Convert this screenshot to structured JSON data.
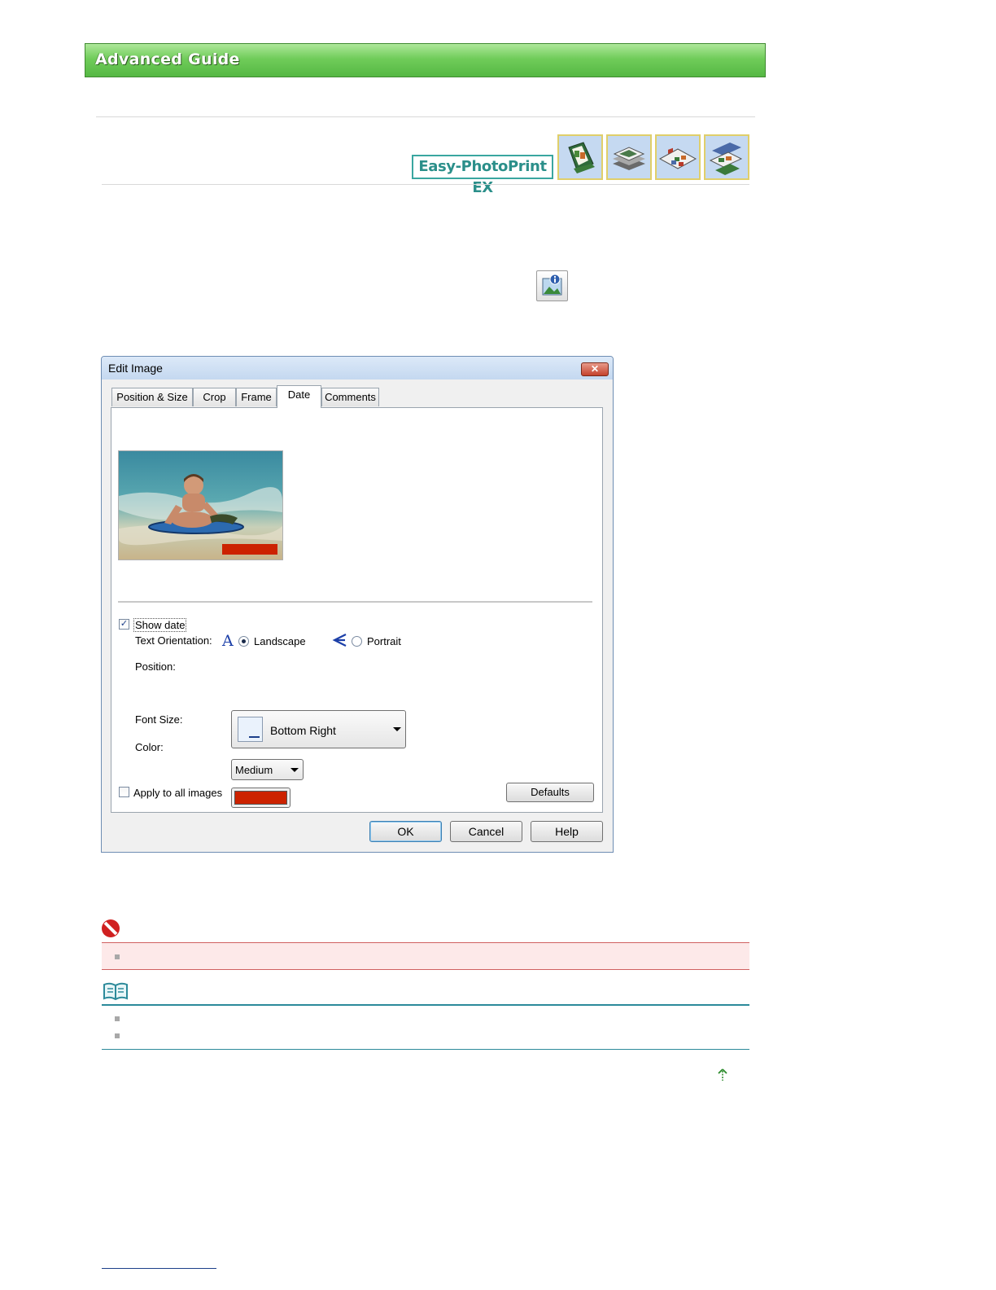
{
  "banner": {
    "title": "Advanced Guide"
  },
  "app_logo": {
    "text": "Easy-PhotoPrint EX"
  },
  "mode_icons": [
    "album-mode-icon",
    "photo-print-mode-icon",
    "layout-print-mode-icon",
    "sticker-mode-icon"
  ],
  "dialog": {
    "title": "Edit Image",
    "close_label": "✕",
    "tabs": [
      {
        "label": "Position & Size"
      },
      {
        "label": "Crop"
      },
      {
        "label": "Frame"
      },
      {
        "label": "Date",
        "active": true
      },
      {
        "label": "Comments"
      }
    ],
    "show_date_label": "Show date",
    "show_date_checked": true,
    "text_orientation_label": "Text Orientation:",
    "landscape_label": "Landscape",
    "portrait_label": "Portrait",
    "orientation_selected": "Landscape",
    "position_label": "Position:",
    "position_value": "Bottom Right",
    "font_size_label": "Font Size:",
    "font_size_value": "Medium",
    "color_label": "Color:",
    "date_color": "#cc2200",
    "apply_all_label": "Apply to all images",
    "apply_all_checked": false,
    "defaults_label": "Defaults",
    "ok_label": "OK",
    "cancel_label": "Cancel",
    "help_label": "Help"
  },
  "colors": {
    "banner_green": "#70cc5a",
    "logo_teal": "#2b8f8a",
    "important_red": "#d06060",
    "note_teal": "#2c8a9a"
  }
}
